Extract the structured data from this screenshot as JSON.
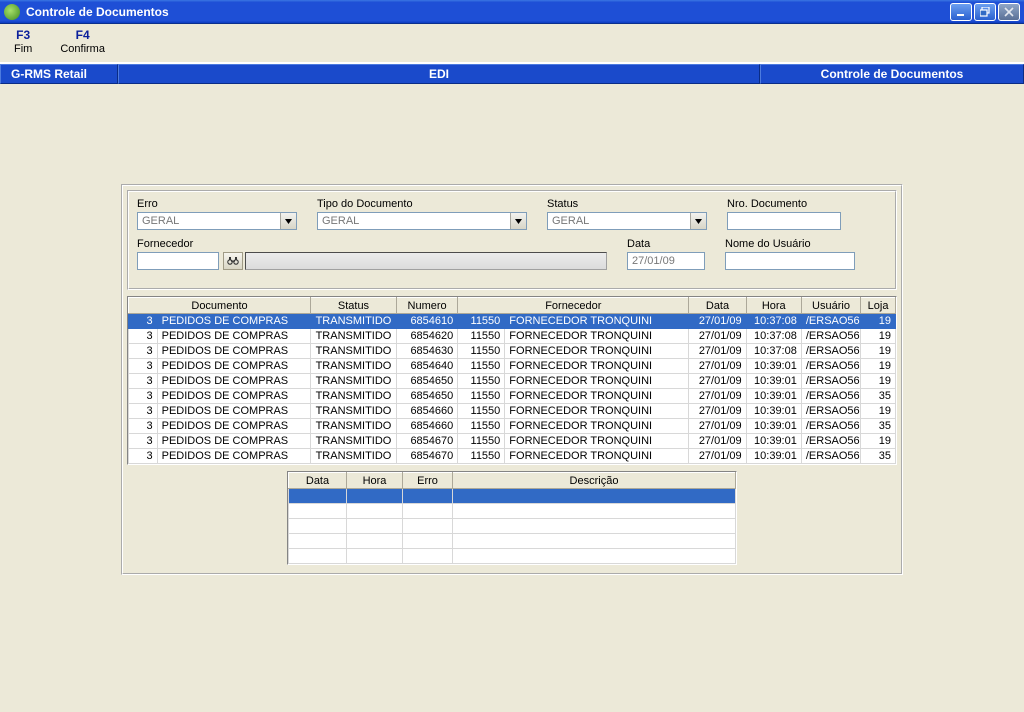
{
  "window": {
    "title": "Controle de Documentos"
  },
  "menu": {
    "f3": {
      "key": "F3",
      "label": "Fim"
    },
    "f4": {
      "key": "F4",
      "label": "Confirma"
    }
  },
  "header": {
    "left": "G-RMS Retail",
    "center": "EDI",
    "right": "Controle de Documentos"
  },
  "filters": {
    "erro": {
      "label": "Erro",
      "value": "GERAL"
    },
    "tipo": {
      "label": "Tipo do Documento",
      "value": "GERAL"
    },
    "status": {
      "label": "Status",
      "value": "GERAL"
    },
    "nro": {
      "label": "Nro. Documento",
      "value": ""
    },
    "fornecedor": {
      "label": "Fornecedor",
      "value": ""
    },
    "data": {
      "label": "Data",
      "value": "27/01/09"
    },
    "usuario": {
      "label": "Nome do Usuário",
      "value": ""
    }
  },
  "mainGrid": {
    "headers": {
      "documento": "Documento",
      "status": "Status",
      "numero": "Numero",
      "fornecedor": "Fornecedor",
      "data": "Data",
      "hora": "Hora",
      "usuario": "Usuário",
      "loja": "Loja"
    },
    "rows": [
      {
        "idx": "3",
        "doc": "PEDIDOS DE COMPRAS",
        "status": "TRANSMITIDO",
        "numero": "6854610",
        "fid": "11550",
        "fnm": "FORNECEDOR TRONQUINI",
        "data": "27/01/09",
        "hora": "10:37:08",
        "usuario": "/ERSAO56",
        "loja": "19",
        "selected": true
      },
      {
        "idx": "3",
        "doc": "PEDIDOS DE COMPRAS",
        "status": "TRANSMITIDO",
        "numero": "6854620",
        "fid": "11550",
        "fnm": "FORNECEDOR TRONQUINI",
        "data": "27/01/09",
        "hora": "10:37:08",
        "usuario": "/ERSAO56",
        "loja": "19"
      },
      {
        "idx": "3",
        "doc": "PEDIDOS DE COMPRAS",
        "status": "TRANSMITIDO",
        "numero": "6854630",
        "fid": "11550",
        "fnm": "FORNECEDOR TRONQUINI",
        "data": "27/01/09",
        "hora": "10:37:08",
        "usuario": "/ERSAO56",
        "loja": "19"
      },
      {
        "idx": "3",
        "doc": "PEDIDOS DE COMPRAS",
        "status": "TRANSMITIDO",
        "numero": "6854640",
        "fid": "11550",
        "fnm": "FORNECEDOR TRONQUINI",
        "data": "27/01/09",
        "hora": "10:39:01",
        "usuario": "/ERSAO56",
        "loja": "19"
      },
      {
        "idx": "3",
        "doc": "PEDIDOS DE COMPRAS",
        "status": "TRANSMITIDO",
        "numero": "6854650",
        "fid": "11550",
        "fnm": "FORNECEDOR TRONQUINI",
        "data": "27/01/09",
        "hora": "10:39:01",
        "usuario": "/ERSAO56",
        "loja": "19"
      },
      {
        "idx": "3",
        "doc": "PEDIDOS DE COMPRAS",
        "status": "TRANSMITIDO",
        "numero": "6854650",
        "fid": "11550",
        "fnm": "FORNECEDOR TRONQUINI",
        "data": "27/01/09",
        "hora": "10:39:01",
        "usuario": "/ERSAO56",
        "loja": "35"
      },
      {
        "idx": "3",
        "doc": "PEDIDOS DE COMPRAS",
        "status": "TRANSMITIDO",
        "numero": "6854660",
        "fid": "11550",
        "fnm": "FORNECEDOR TRONQUINI",
        "data": "27/01/09",
        "hora": "10:39:01",
        "usuario": "/ERSAO56",
        "loja": "19"
      },
      {
        "idx": "3",
        "doc": "PEDIDOS DE COMPRAS",
        "status": "TRANSMITIDO",
        "numero": "6854660",
        "fid": "11550",
        "fnm": "FORNECEDOR TRONQUINI",
        "data": "27/01/09",
        "hora": "10:39:01",
        "usuario": "/ERSAO56",
        "loja": "35"
      },
      {
        "idx": "3",
        "doc": "PEDIDOS DE COMPRAS",
        "status": "TRANSMITIDO",
        "numero": "6854670",
        "fid": "11550",
        "fnm": "FORNECEDOR TRONQUINI",
        "data": "27/01/09",
        "hora": "10:39:01",
        "usuario": "/ERSAO56",
        "loja": "19"
      },
      {
        "idx": "3",
        "doc": "PEDIDOS DE COMPRAS",
        "status": "TRANSMITIDO",
        "numero": "6854670",
        "fid": "11550",
        "fnm": "FORNECEDOR TRONQUINI",
        "data": "27/01/09",
        "hora": "10:39:01",
        "usuario": "/ERSAO56",
        "loja": "35"
      }
    ]
  },
  "detailGrid": {
    "headers": {
      "data": "Data",
      "hora": "Hora",
      "erro": "Erro",
      "descricao": "Descrição"
    }
  }
}
